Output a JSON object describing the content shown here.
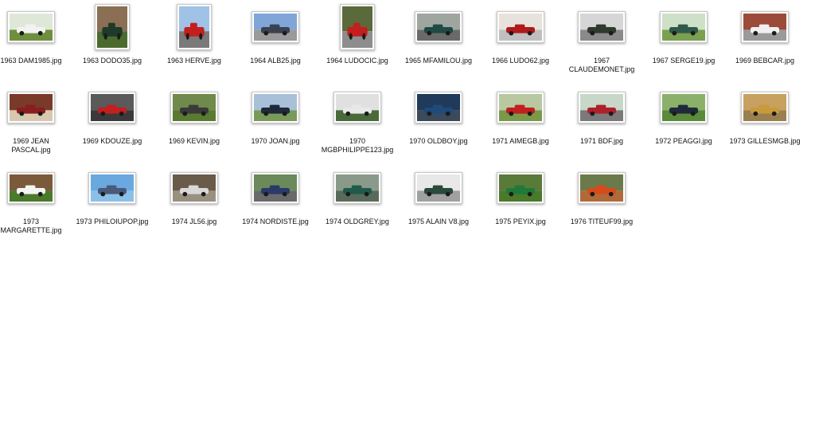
{
  "files": [
    {
      "name": "1963 DAM1985.jpg",
      "orientation": "landscape",
      "scene": {
        "sky": "#dfe8d8",
        "ground": "#6f8f3e",
        "car": "#f2f2f2"
      }
    },
    {
      "name": "1963 DODO35.jpg",
      "orientation": "portrait",
      "scene": {
        "sky": "#8a6f55",
        "ground": "#4b6b2e",
        "car": "#1f3a2a"
      }
    },
    {
      "name": "1963 HERVE.jpg",
      "orientation": "portrait",
      "scene": {
        "sky": "#9fc2e6",
        "ground": "#7a7a7a",
        "car": "#c41e1e"
      }
    },
    {
      "name": "1964 ALB25.jpg",
      "orientation": "landscape",
      "scene": {
        "sky": "#7fa6d6",
        "ground": "#9a9a9a",
        "car": "#3a4150"
      }
    },
    {
      "name": "1964 LUDOCIC.jpg",
      "orientation": "portrait",
      "scene": {
        "sky": "#5a6a3a",
        "ground": "#8d8d8d",
        "car": "#c41e1e"
      }
    },
    {
      "name": "1965 MFAMILOU.jpg",
      "orientation": "landscape",
      "scene": {
        "sky": "#9fa6a0",
        "ground": "#6a6a6a",
        "car": "#1f4a44"
      }
    },
    {
      "name": "1966 LUDO62.jpg",
      "orientation": "landscape",
      "scene": {
        "sky": "#e8e2dc",
        "ground": "#bfbfbf",
        "car": "#b01a1a"
      }
    },
    {
      "name": "1967 CLAUDEMONET.jpg",
      "orientation": "landscape",
      "scene": {
        "sky": "#d6d6d6",
        "ground": "#8a8a8a",
        "car": "#2f3a2c"
      }
    },
    {
      "name": "1967 SERGE19.jpg",
      "orientation": "landscape",
      "scene": {
        "sky": "#cfe0c8",
        "ground": "#7aa050",
        "car": "#2f5a4a"
      }
    },
    {
      "name": "1969 BEBCAR.jpg",
      "orientation": "landscape",
      "scene": {
        "sky": "#9c4b3a",
        "ground": "#9a9a9a",
        "car": "#f0f0f0"
      }
    },
    {
      "name": "1969 JEAN PASCAL.jpg",
      "orientation": "landscape",
      "scene": {
        "sky": "#7a3a2a",
        "ground": "#d8c8b0",
        "car": "#8a1e1e"
      }
    },
    {
      "name": "1969 KDOUZE.jpg",
      "orientation": "landscape",
      "scene": {
        "sky": "#5a5a5a",
        "ground": "#3a3a3a",
        "car": "#c41e1e"
      }
    },
    {
      "name": "1969 KEVIN.jpg",
      "orientation": "landscape",
      "scene": {
        "sky": "#6f8a4a",
        "ground": "#5a7a32",
        "car": "#3a3a3a"
      }
    },
    {
      "name": "1970 JOAN.jpg",
      "orientation": "landscape",
      "scene": {
        "sky": "#a8c0d8",
        "ground": "#7a9a5a",
        "car": "#1f2a3a"
      }
    },
    {
      "name": "1970 MGBPHILIPPE123.jpg",
      "orientation": "landscape",
      "scene": {
        "sky": "#e0e0e0",
        "ground": "#4a6a3a",
        "car": "#e8e8e8"
      }
    },
    {
      "name": "1970 OLDBOY.jpg",
      "orientation": "landscape",
      "scene": {
        "sky": "#1f3a5a",
        "ground": "#3a4a5a",
        "car": "#1f4a7a"
      }
    },
    {
      "name": "1971 AIMEGB.jpg",
      "orientation": "landscape",
      "scene": {
        "sky": "#b8c8a0",
        "ground": "#7a9a4a",
        "car": "#c41e1e"
      }
    },
    {
      "name": "1971 BDF.jpg",
      "orientation": "landscape",
      "scene": {
        "sky": "#c8d8c8",
        "ground": "#7a7a7a",
        "car": "#b0202a"
      }
    },
    {
      "name": "1972 PEAGGI.jpg",
      "orientation": "landscape",
      "scene": {
        "sky": "#8ab06a",
        "ground": "#5a8a3a",
        "car": "#1f2a3a"
      }
    },
    {
      "name": "1973 GILLESMGB.jpg",
      "orientation": "landscape",
      "scene": {
        "sky": "#c8a060",
        "ground": "#9a8050",
        "car": "#c89a3a"
      }
    },
    {
      "name": "1973 MARGARETTE.jpg",
      "orientation": "landscape",
      "scene": {
        "sky": "#7a5a3a",
        "ground": "#4a7a2a",
        "car": "#f4f4f4"
      }
    },
    {
      "name": "1973 PHILOIUPOP.jpg",
      "orientation": "landscape",
      "scene": {
        "sky": "#6aa8e0",
        "ground": "#8ac0e8",
        "car": "#4a5a7a"
      }
    },
    {
      "name": "1974 JL56.jpg",
      "orientation": "landscape",
      "scene": {
        "sky": "#6a5a4a",
        "ground": "#9a9080",
        "car": "#d8d8d8"
      }
    },
    {
      "name": "1974 NORDISTE.jpg",
      "orientation": "landscape",
      "scene": {
        "sky": "#6a8a5a",
        "ground": "#6a6a6a",
        "car": "#2a3a6a"
      }
    },
    {
      "name": "1974 OLDGREY.jpg",
      "orientation": "landscape",
      "scene": {
        "sky": "#8a9a8a",
        "ground": "#5a6a5a",
        "car": "#1f5a4a"
      }
    },
    {
      "name": "1975 ALAIN V8.jpg",
      "orientation": "landscape",
      "scene": {
        "sky": "#e8e8e8",
        "ground": "#a0a0a0",
        "car": "#2a4a3a"
      }
    },
    {
      "name": "1975 PEYIX.jpg",
      "orientation": "landscape",
      "scene": {
        "sky": "#5a7a3a",
        "ground": "#4a7a2a",
        "car": "#1f7a3a"
      }
    },
    {
      "name": "1976 TITEUF99.jpg",
      "orientation": "landscape",
      "scene": {
        "sky": "#6a7a4a",
        "ground": "#b06a3a",
        "car": "#d84a1a"
      }
    }
  ]
}
